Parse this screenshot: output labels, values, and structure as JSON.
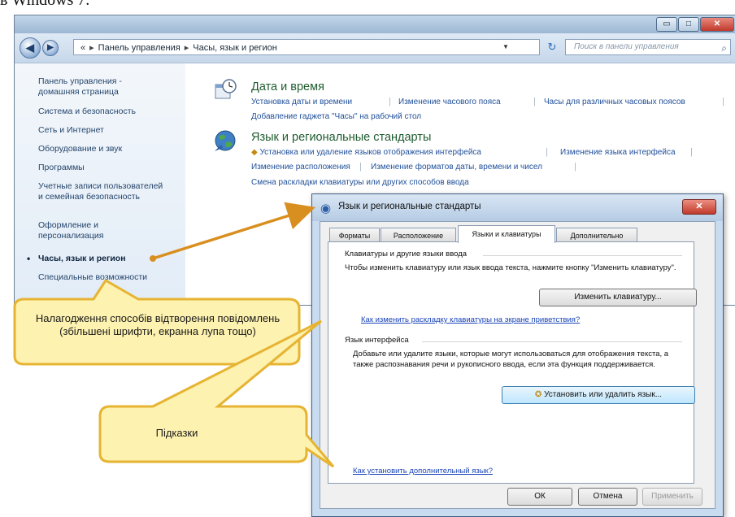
{
  "caption": "в Windows 7.",
  "window": {
    "controls": {
      "minimize": "▭",
      "maximize": "□",
      "close": "✕"
    },
    "address": {
      "root_glyph": "«",
      "crumbs": [
        "Панель управления",
        "Часы, язык и регион"
      ],
      "separator": "▸",
      "dropdown": "▼",
      "refresh": "↻"
    },
    "search": {
      "placeholder": "Поиск в панели управления",
      "icon": "⌕"
    },
    "nav": {
      "back": "◀",
      "forward": "▶"
    }
  },
  "sidebar": {
    "items": [
      {
        "label": "Панель управления - домашняя страница"
      },
      {
        "label": "Система и безопасность"
      },
      {
        "label": "Сеть и Интернет"
      },
      {
        "label": "Оборудование и звук"
      },
      {
        "label": "Программы"
      },
      {
        "label": "Учетные записи пользователей и семейная безопасность"
      },
      {
        "label": "Оформление и персонализация"
      },
      {
        "label": "Часы, язык и регион",
        "active": true
      },
      {
        "label": "Специальные возможности"
      }
    ],
    "bullet": "•"
  },
  "categories": [
    {
      "title": "Дата и время",
      "links": [
        "Установка даты и времени",
        "Изменение часового пояса",
        "Часы для различных часовых поясов",
        "Добавление гаджета \"Часы\" на рабочий стол"
      ]
    },
    {
      "title": "Язык и региональные стандарты",
      "links": [
        "Установка или удаление языков отображения интерфейса",
        "Изменение языка интерфейса",
        "Изменение расположения",
        "Изменение форматов даты, времени и чисел",
        "Смена раскладки клавиатуры или других способов ввода"
      ]
    }
  ],
  "dialog": {
    "title": "Язык и региональные стандарты",
    "title_icon": "◉",
    "close": "✕",
    "tabs": [
      "Форматы",
      "Расположение",
      "Языки и клавиатуры",
      "Дополнительно"
    ],
    "active_tab": 2,
    "keyboards": {
      "title": "Клавиатуры и другие языки ввода",
      "text": "Чтобы изменить клавиатуру или язык ввода текста, нажмите кнопку \"Изменить клавиатуру\".",
      "button": "Изменить клавиатуру...",
      "link": "Как изменить раскладку клавиатуры на экране приветствия?"
    },
    "interface_lang": {
      "title": "Язык интерфейса",
      "text": "Добавьте или удалите языки, которые могут использоваться для отображения текста, а также распознавания речи и рукописного ввода, если эта функция поддерживается.",
      "button_icon": "✪",
      "button": "Установить или удалить язык..."
    },
    "bottom_link": "Как установить дополнительный язык?",
    "buttons": {
      "ok": "ОК",
      "cancel": "Отмена",
      "apply": "Применить"
    }
  },
  "callouts": [
    {
      "text": "Налагодження способів відтворення повідомлень (збільшені шрифти, екранна лупа тощо)"
    },
    {
      "text": "Підказки"
    }
  ],
  "colors": {
    "callout_fill": "#fdf2b0",
    "callout_stroke": "#e6b432",
    "arrow": "#d98f1f",
    "link": "#1f4f9a",
    "category_title": "#1e5c2e"
  }
}
